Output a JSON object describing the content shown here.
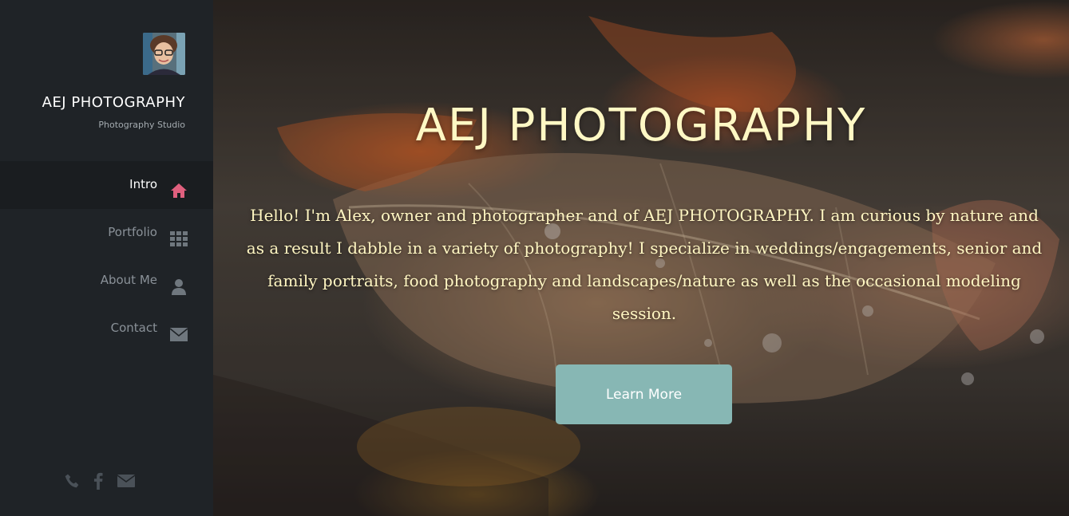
{
  "sidebar": {
    "brand_title": "AEJ PHOTOGRAPHY",
    "brand_subtitle": "Photography Studio",
    "nav": [
      {
        "label": "Intro",
        "icon": "home-icon",
        "active": true
      },
      {
        "label": "Portfolio",
        "icon": "grid-icon",
        "active": false
      },
      {
        "label": "About Me",
        "icon": "user-icon",
        "active": false
      },
      {
        "label": "Contact",
        "icon": "envelope-icon",
        "active": false
      }
    ],
    "social": [
      "phone-icon",
      "facebook-icon",
      "email-icon"
    ]
  },
  "hero": {
    "title": "AEJ PHOTOGRAPHY",
    "text": "Hello! I'm Alex, owner and photographer and of AEJ PHOTOGRAPHY. I am curious by nature and as a result I dabble in a variety of photography! I specialize in weddings/engagements, senior and family portraits, food photography and landscapes/nature as well as the occasional modeling session.",
    "cta_label": "Learn More"
  },
  "colors": {
    "sidebar_bg": "#1f2327",
    "active_icon": "#e0607e",
    "inactive_icon": "#6f777e",
    "hero_text": "#fff6c2",
    "cta_bg": "#87b7b4"
  }
}
